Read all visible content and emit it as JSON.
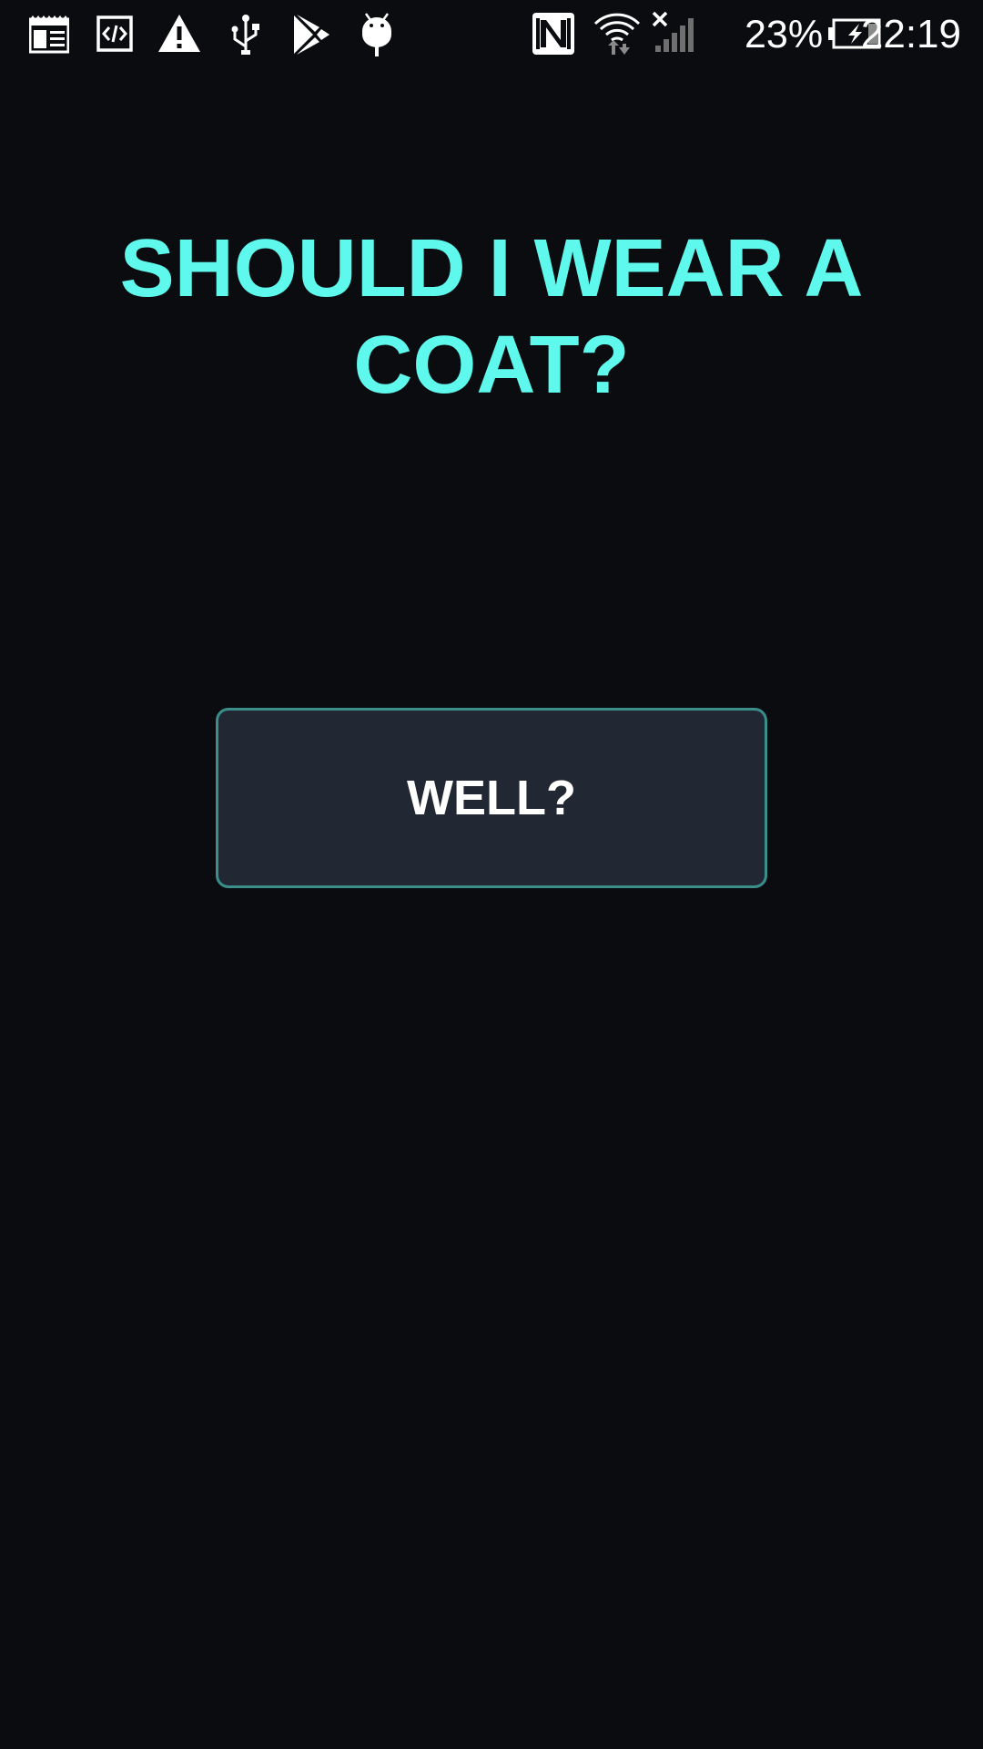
{
  "status_bar": {
    "left_icons": [
      "news-icon",
      "code-icon",
      "warning-icon",
      "usb-icon",
      "play-store-icon",
      "android-debug-icon"
    ],
    "right_icons": [
      "nfc-icon",
      "wifi-icon",
      "signal-no-service-icon",
      "battery-charging-icon"
    ],
    "battery_percent": "23%",
    "battery_level": 0.23,
    "time": "22:19"
  },
  "main": {
    "title": "SHOULD I WEAR A COAT?",
    "button_label": "WELL?"
  },
  "colors": {
    "background": "#0a0c10",
    "title": "#5ff8ec",
    "button_background": "#212833",
    "button_border": "#3a8f8b",
    "button_text": "#ffffff"
  }
}
